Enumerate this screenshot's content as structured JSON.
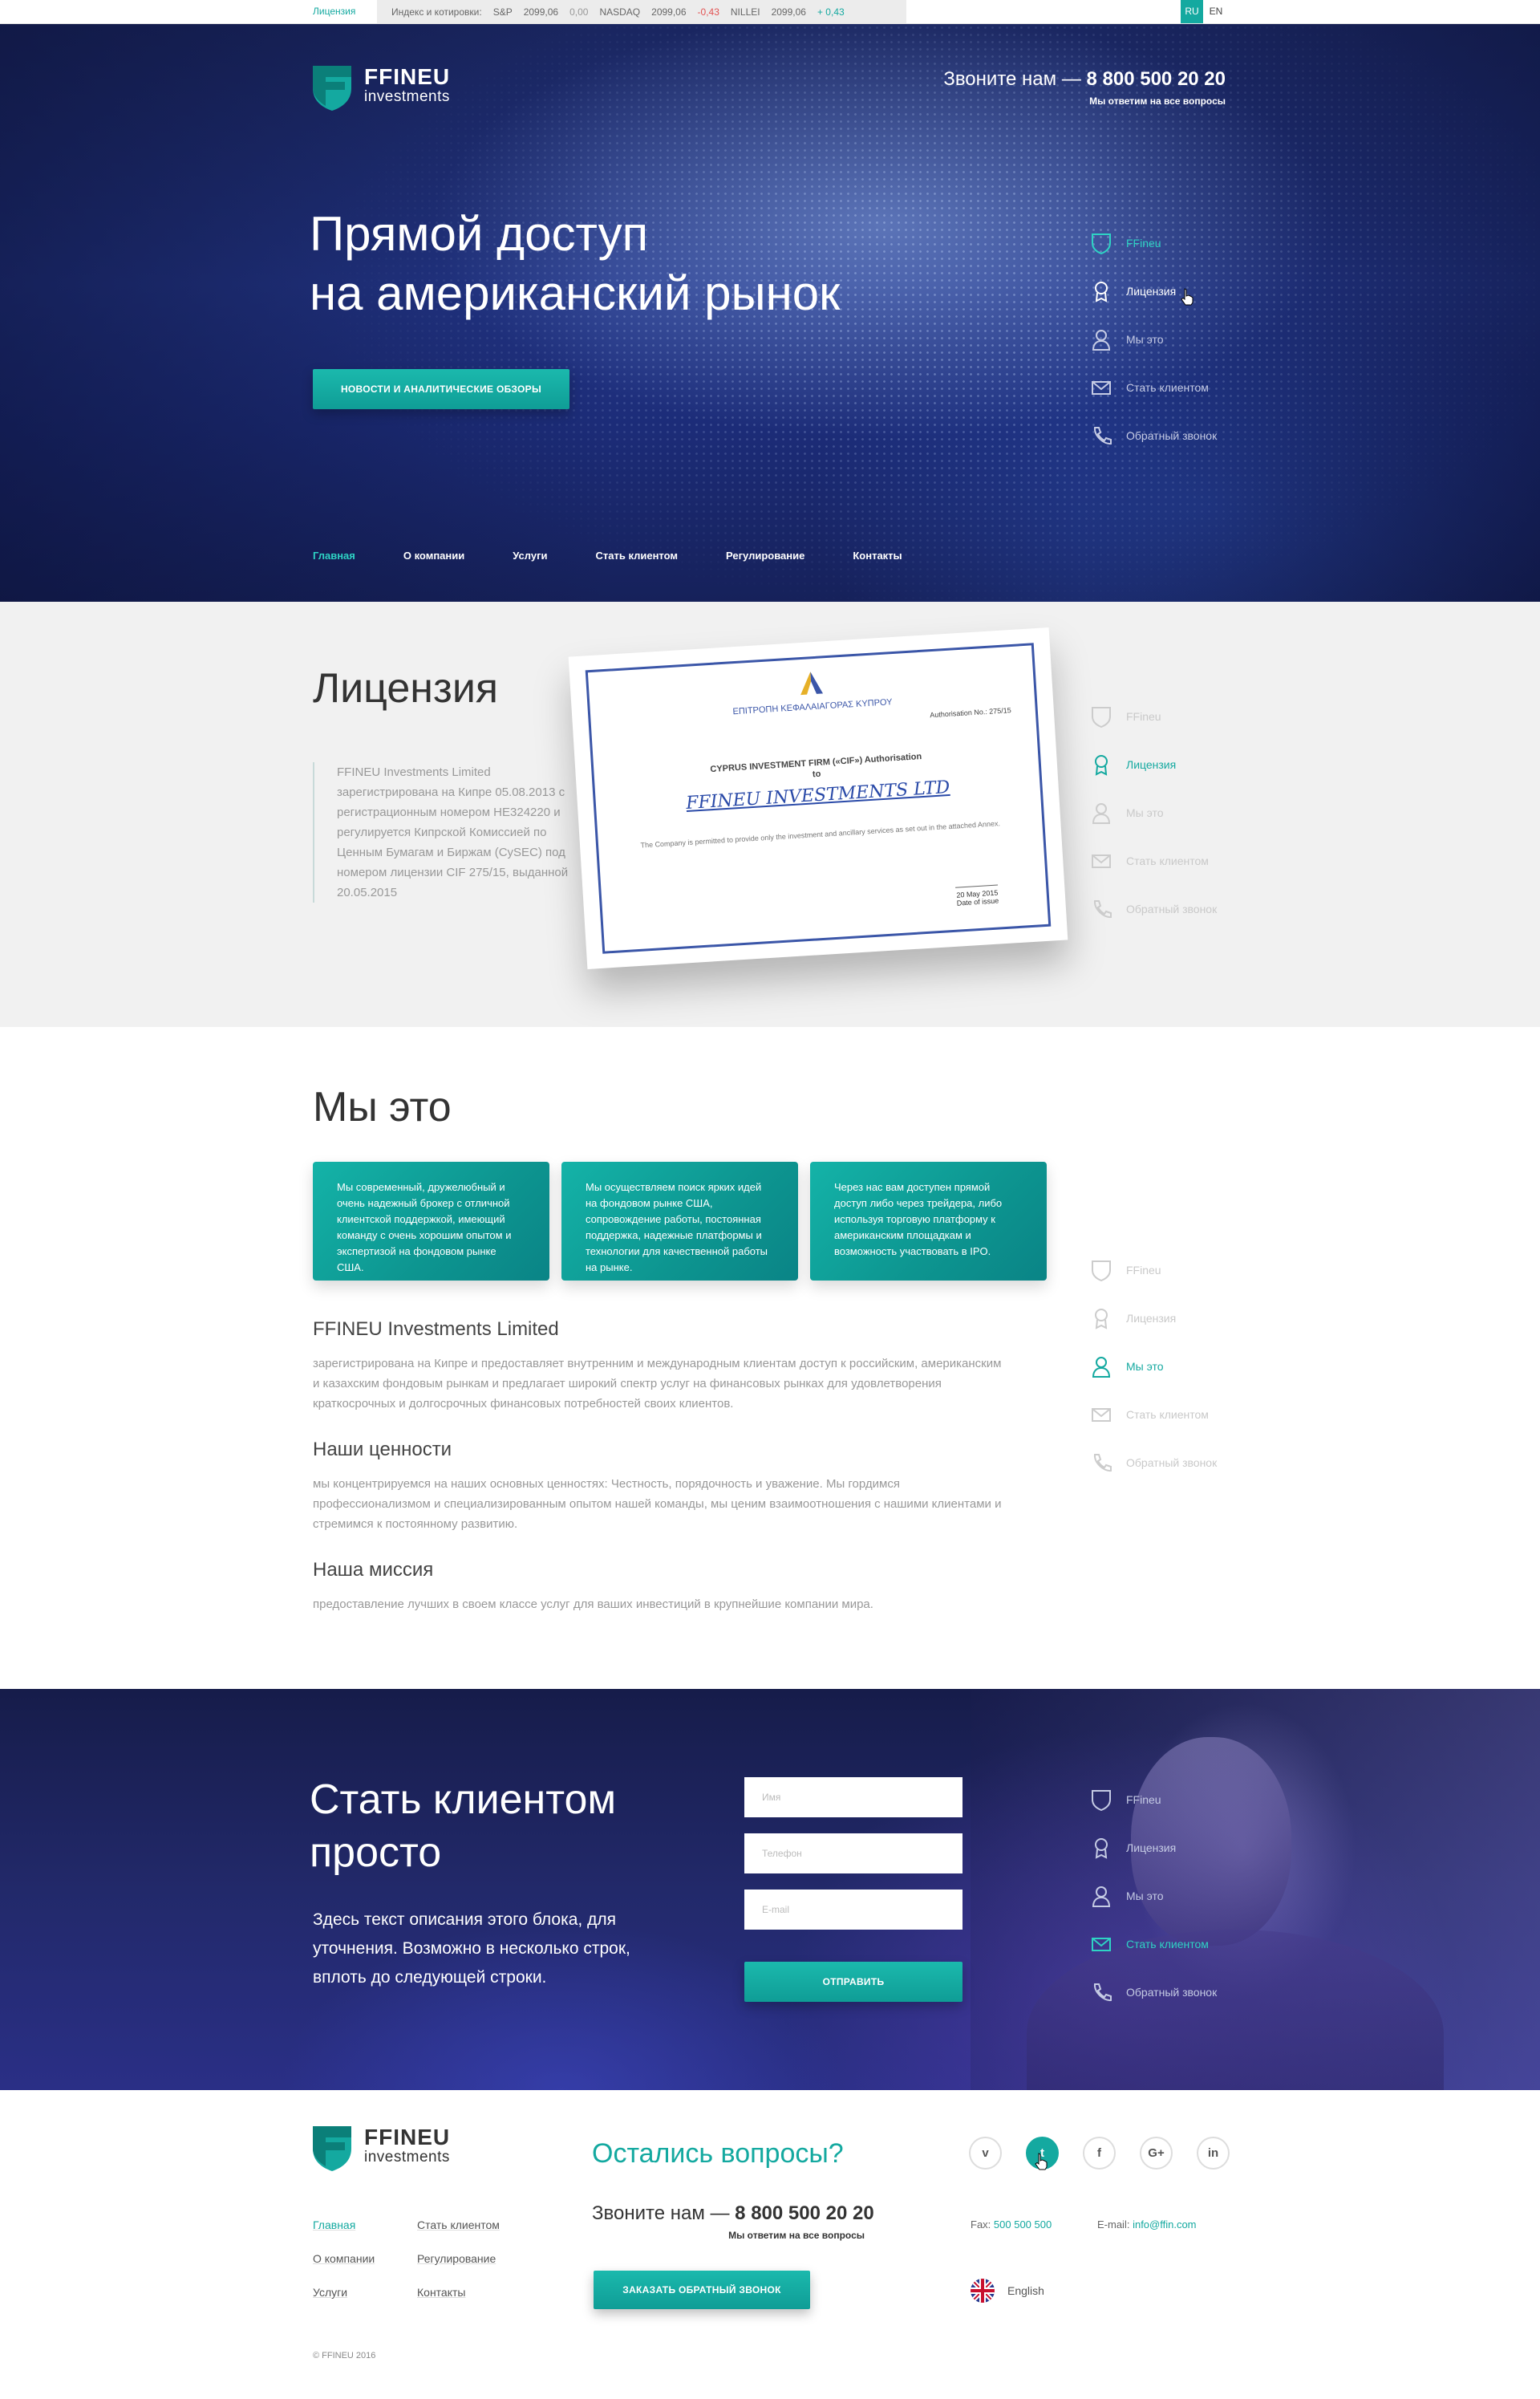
{
  "ticker": {
    "license_link": "Лицензия",
    "index_label": "Индекс и котировки:",
    "quotes": [
      {
        "name": "S&P",
        "value": "2099,06",
        "change": "0,00",
        "dir": "neu"
      },
      {
        "name": "NASDAQ",
        "value": "2099,06",
        "change": "-0,43",
        "dir": "neg"
      },
      {
        "name": "NILLEI",
        "value": "2099,06",
        "change": "+ 0,43",
        "dir": "pos"
      }
    ],
    "lang_ru": "RU",
    "lang_en": "EN"
  },
  "brand": {
    "name": "FFINEU",
    "sub": "investments"
  },
  "contact": {
    "call_prefix": "Звоните нам —",
    "phone": "8 800 500 20 20",
    "note": "Мы ответим на все вопросы"
  },
  "hero": {
    "title_line1": "Прямой доступ",
    "title_line2": "на американский рынок",
    "button": "НОВОСТИ И АНАЛИТИЧЕСКИЕ ОБЗОРЫ"
  },
  "main_nav": [
    "Главная",
    "О компании",
    "Услуги",
    "Стать клиентом",
    "Регулирование",
    "Контакты"
  ],
  "side_nav": [
    "FFineu",
    "Лицензия",
    "Мы это",
    "Стать клиентом",
    "Обратный звонок"
  ],
  "license": {
    "title": "Лицензия",
    "text": "FFINEU Investments Limited зарегистрирована на Кипре 05.08.2013 с регистрационным номером HE324220 и регулируется Кипрской Комиссией по Ценным Бумагам и Биржам (CySEC) под номером лицензии CIF 275/15, выданной 20.05.2015",
    "cert": {
      "org": "ΕΠΙΤΡΟΠΗ ΚΕΦΑΛΑΙΑΓΟΡΑΣ ΚΥΠΡΟΥ",
      "auth_no": "Authorisation No.: 275/15",
      "title": "CYPRUS INVESTMENT FIRM («CIF») Authorisation",
      "to": "to",
      "company": "FFINEU INVESTMENTS LTD",
      "fine": "The Company is permitted to provide only the investment and ancillary services as set out in the attached Annex.",
      "date": "20 May 2015",
      "date_label": "Date of issue"
    }
  },
  "about": {
    "title": "Мы это",
    "cards": [
      "Мы современный, дружелюбный и очень надежный брокер с отличной клиентской поддержкой, имеющий команду с очень хорошим опытом и экспертизой на фондовом рынке США.",
      "Мы осуществляем поиск ярких идей на фондовом рынке США, сопровождение работы, постоянная поддержка, надежные платформы и технологии для качественной работы на рынке.",
      "Через нас вам доступен прямой доступ либо через трейдера, либо используя торговую платформу к американским площадкам и возможность участвовать в IPO."
    ],
    "company_title": "FFINEU Investments Limited",
    "company_text": "зарегистрирована на Кипре и предоставляет внутренним и международным клиентам доступ к российским, американским и казахским фондовым рынкам и предлагает широкий спектр услуг на финансовых рынках для удовлетворения краткосрочных и долгосрочных финансовых потребностей своих клиентов.",
    "values_title": "Наши ценности",
    "values_text": "мы концентрируемся на наших основных ценностях: Честность, порядочность и уважение. Мы гордимся профессионализмом и специализированным опытом нашей команды, мы ценим взаимоотношения с нашими клиентами и стремимся к постоянному развитию.",
    "mission_title": "Наша миссия",
    "mission_text": "предоставление лучших в своем классе услуг для ваших инвестиций в крупнейшие компании мира."
  },
  "client": {
    "title_line1": "Стать клиентом",
    "title_line2": "просто",
    "desc": "Здесь текст описания этого блока, для уточнения. Возможно в несколько строк, вплоть до следующей строки.",
    "name_ph": "Имя",
    "phone_ph": "Телефон",
    "email_ph": "E-mail",
    "submit": "ОТПРАВИТЬ"
  },
  "footer": {
    "nav": [
      "Главная",
      "Стать клиентом",
      "О компании",
      "Регулирование",
      "Услуги",
      "Контакты"
    ],
    "copyright": "© FFINEU 2016",
    "question": "Остались вопросы?",
    "callback_button": "ЗАКАЗАТЬ ОБРАТНЫЙ ЗВОНОК",
    "social": [
      "v",
      "t",
      "f",
      "G+",
      "in"
    ],
    "fax_label": "Fax:",
    "fax": "500 500 500",
    "email_label": "E-mail:",
    "email": "info@ffin.com",
    "language": "English"
  },
  "colors": {
    "accent": "#14a9a0",
    "hero_bg": "#1f2f7a",
    "negative": "#e25353"
  }
}
